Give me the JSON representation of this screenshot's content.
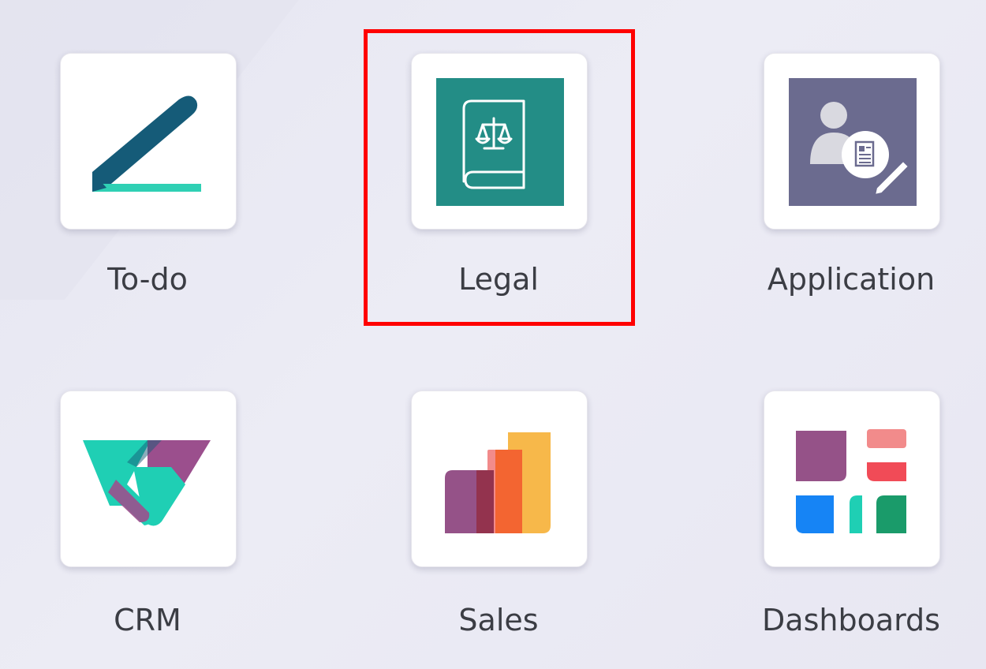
{
  "apps": [
    {
      "label": "To-do",
      "icon": "todo-pen-icon"
    },
    {
      "label": "Legal",
      "icon": "legal-scales-book-icon"
    },
    {
      "label": "Application",
      "icon": "application-person-document-icon"
    },
    {
      "label": "CRM",
      "icon": "crm-handshake-icon"
    },
    {
      "label": "Sales",
      "icon": "sales-bar-chart-icon"
    },
    {
      "label": "Dashboards",
      "icon": "dashboards-blocks-icon"
    }
  ],
  "highlighted_app": "Legal",
  "colors": {
    "highlight_border": "#ff0000",
    "legal_bg": "#238d86",
    "application_bg": "#6b6b8f",
    "todo_dark": "#155b78",
    "todo_accent": "#2fd0b4",
    "crm_teal": "#1fcfb4",
    "crm_purple": "#9b4f8d",
    "sales_purple": "#955288",
    "sales_orange": "#f36531",
    "sales_yellow": "#f7b84a",
    "sales_pink": "#f28b8b"
  }
}
